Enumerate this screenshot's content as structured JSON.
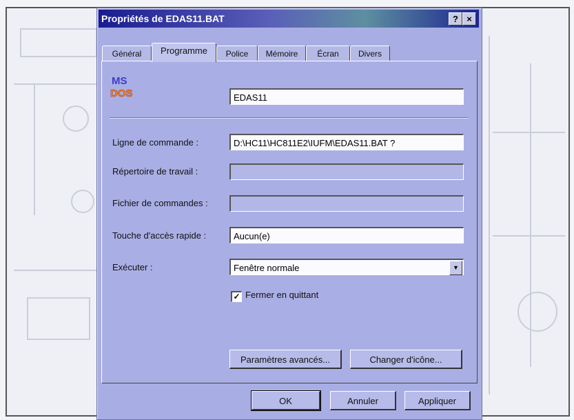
{
  "dialog": {
    "title": "Propriétés de EDAS11.BAT",
    "help_button": "?",
    "close_button": "×"
  },
  "tabs": [
    {
      "label": "Général"
    },
    {
      "label": "Programme",
      "active": true
    },
    {
      "label": "Police"
    },
    {
      "label": "Mémoire"
    },
    {
      "label": "Écran"
    },
    {
      "label": "Divers"
    }
  ],
  "program": {
    "icon_text_top": "MS",
    "icon_text_bottom": "DOS",
    "name_value": "EDAS11"
  },
  "form": {
    "command_line": {
      "label": "Ligne de commande :",
      "value": "D:\\HC11\\HC811E2\\IUFM\\EDAS11.BAT ?"
    },
    "working_dir": {
      "label": "Répertoire de travail :",
      "value": ""
    },
    "batch_file": {
      "label": "Fichier de commandes :",
      "value": ""
    },
    "shortcut_key": {
      "label": "Touche d'accès rapide :",
      "value": "Aucun(e)"
    },
    "run": {
      "label": "Exécuter :",
      "value": "Fenêtre normale"
    },
    "close_on_exit": {
      "label": "Fermer en quittant",
      "checked": true
    }
  },
  "panel_buttons": {
    "advanced": "Paramètres avancés...",
    "change_icon": "Changer d'icône..."
  },
  "footer_buttons": {
    "ok": "OK",
    "cancel": "Annuler",
    "apply": "Appliquer"
  }
}
